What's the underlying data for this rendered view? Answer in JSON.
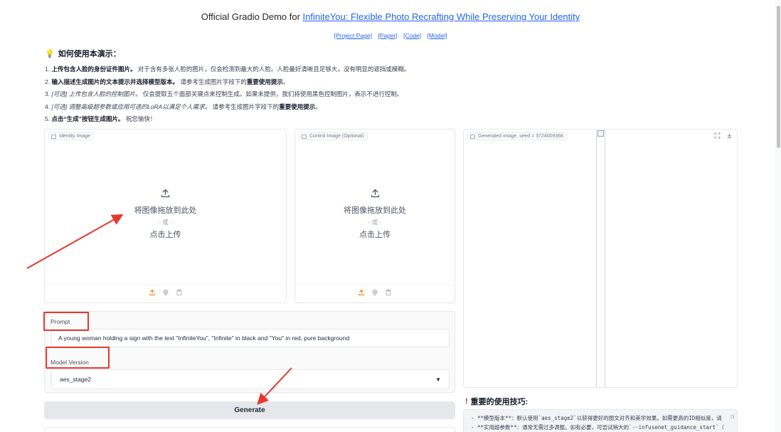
{
  "header": {
    "title_prefix": "Official Gradio Demo for ",
    "title_link": "InfiniteYou: Flexible Photo Recrafting While Preserving Your Identity",
    "links": [
      "[Project Page]",
      "[Paper]",
      "[Code]",
      "[Model]"
    ]
  },
  "howto": {
    "heading": "如何使用本演示：",
    "steps": [
      {
        "num": "1. ",
        "bold": "上传包含人脸的身份证件图片。",
        "rest": " 对于含有多张人脸的图片，仅会检测到最大的人脸。人脸最好清晰且足够大，没有明显的遮挡或模糊。"
      },
      {
        "num": "2. ",
        "bold": "输入描述生成图片的文本提示并选择模型版本。",
        "rest": " 请参考生成图片字段下的",
        "bold2": "重要使用提示",
        "rest2": "。"
      },
      {
        "num": "3. ",
        "italic": "[可选] 上传包含人脸的控制图片。",
        "rest": " 仅会提取五个面部关键点来控制生成。如果未提供，我们将使用黑色控制图片，表示不进行控制。"
      },
      {
        "num": "4. ",
        "italic": "[可选] 调整高级超参数或应用可选的LoRA以满足个人需求。",
        "rest": " 请参考生成图片字段下的",
        "bold2": "重要使用提示",
        "rest2": "。"
      },
      {
        "num": "5. ",
        "bold": "点击“生成”按钮生成图片。",
        "rest": " 祝您愉快！"
      }
    ]
  },
  "identity_panel": {
    "label": "Identity Image",
    "drop_text": "将图像拖放到此处",
    "or_text": "- 或 -",
    "click_text": "点击上传"
  },
  "control_panel": {
    "label": "Control Image (Optional)",
    "drop_text": "将图像拖放到此处",
    "or_text": "- 或 -",
    "click_text": "点击上传"
  },
  "prompt": {
    "label": "Prompt",
    "value": "A young woman holding a sign with the text \"InfiniteYou\", \"Infinite\" in black and \"You\" in red, pure background"
  },
  "model_version": {
    "label": "Model Version",
    "selected": "aes_stage2"
  },
  "generate_label": "Generate",
  "output": {
    "label": "Generated image, seed = 3724009366"
  },
  "tips": {
    "heading": "重要的使用技巧:",
    "lines": [
      "- **模型版本**：默认使用`aes_stage2`以获得更好的图文对齐和美学效果。如需更高的ID相似度，请",
      "- **实用超参数**：通常无需过多调整。如有必要，可尝试稍大的`--infusenet_guidance_start`（"
    ]
  },
  "colors": {
    "accent_link": "#2563eb",
    "annotation_red": "#e5392f",
    "upload_orange": "#f97316"
  }
}
